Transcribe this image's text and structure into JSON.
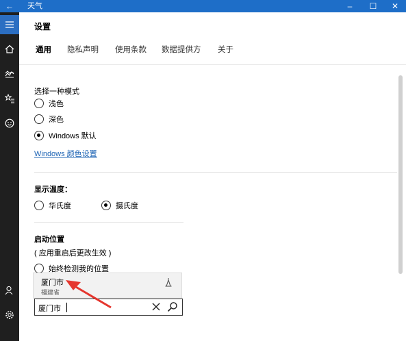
{
  "window": {
    "title": "天气",
    "back_icon": "back-arrow-icon",
    "minimize_icon": "minimize-icon",
    "maximize_icon": "maximize-icon",
    "close_icon": "close-icon",
    "accent_color": "#1e6ec8"
  },
  "nav": {
    "items": [
      "hamburger-icon",
      "home-icon",
      "chart-icon",
      "favorites-icon",
      "smiley-icon",
      "user-icon",
      "settings-icon"
    ]
  },
  "header": {
    "title": "设置",
    "tabs": [
      "通用",
      "隐私声明",
      "使用条款",
      "数据提供方",
      "关于"
    ]
  },
  "mode": {
    "label": "选择一种模式",
    "options": [
      "浅色",
      "深色",
      "Windows 默认"
    ],
    "selected": "Windows 默认",
    "link": "Windows 颜色设置"
  },
  "temperature": {
    "label": "显示温度：",
    "options": [
      "华氏度",
      "摄氏度"
    ],
    "selected": "摄氏度"
  },
  "startup": {
    "label": "启动位置",
    "note": "( 应用重启后更改生效 )",
    "option": "始终检测我的位置"
  },
  "suggestion": {
    "city": "厦门市",
    "province": "福建省"
  },
  "search": {
    "value": "厦门市"
  }
}
